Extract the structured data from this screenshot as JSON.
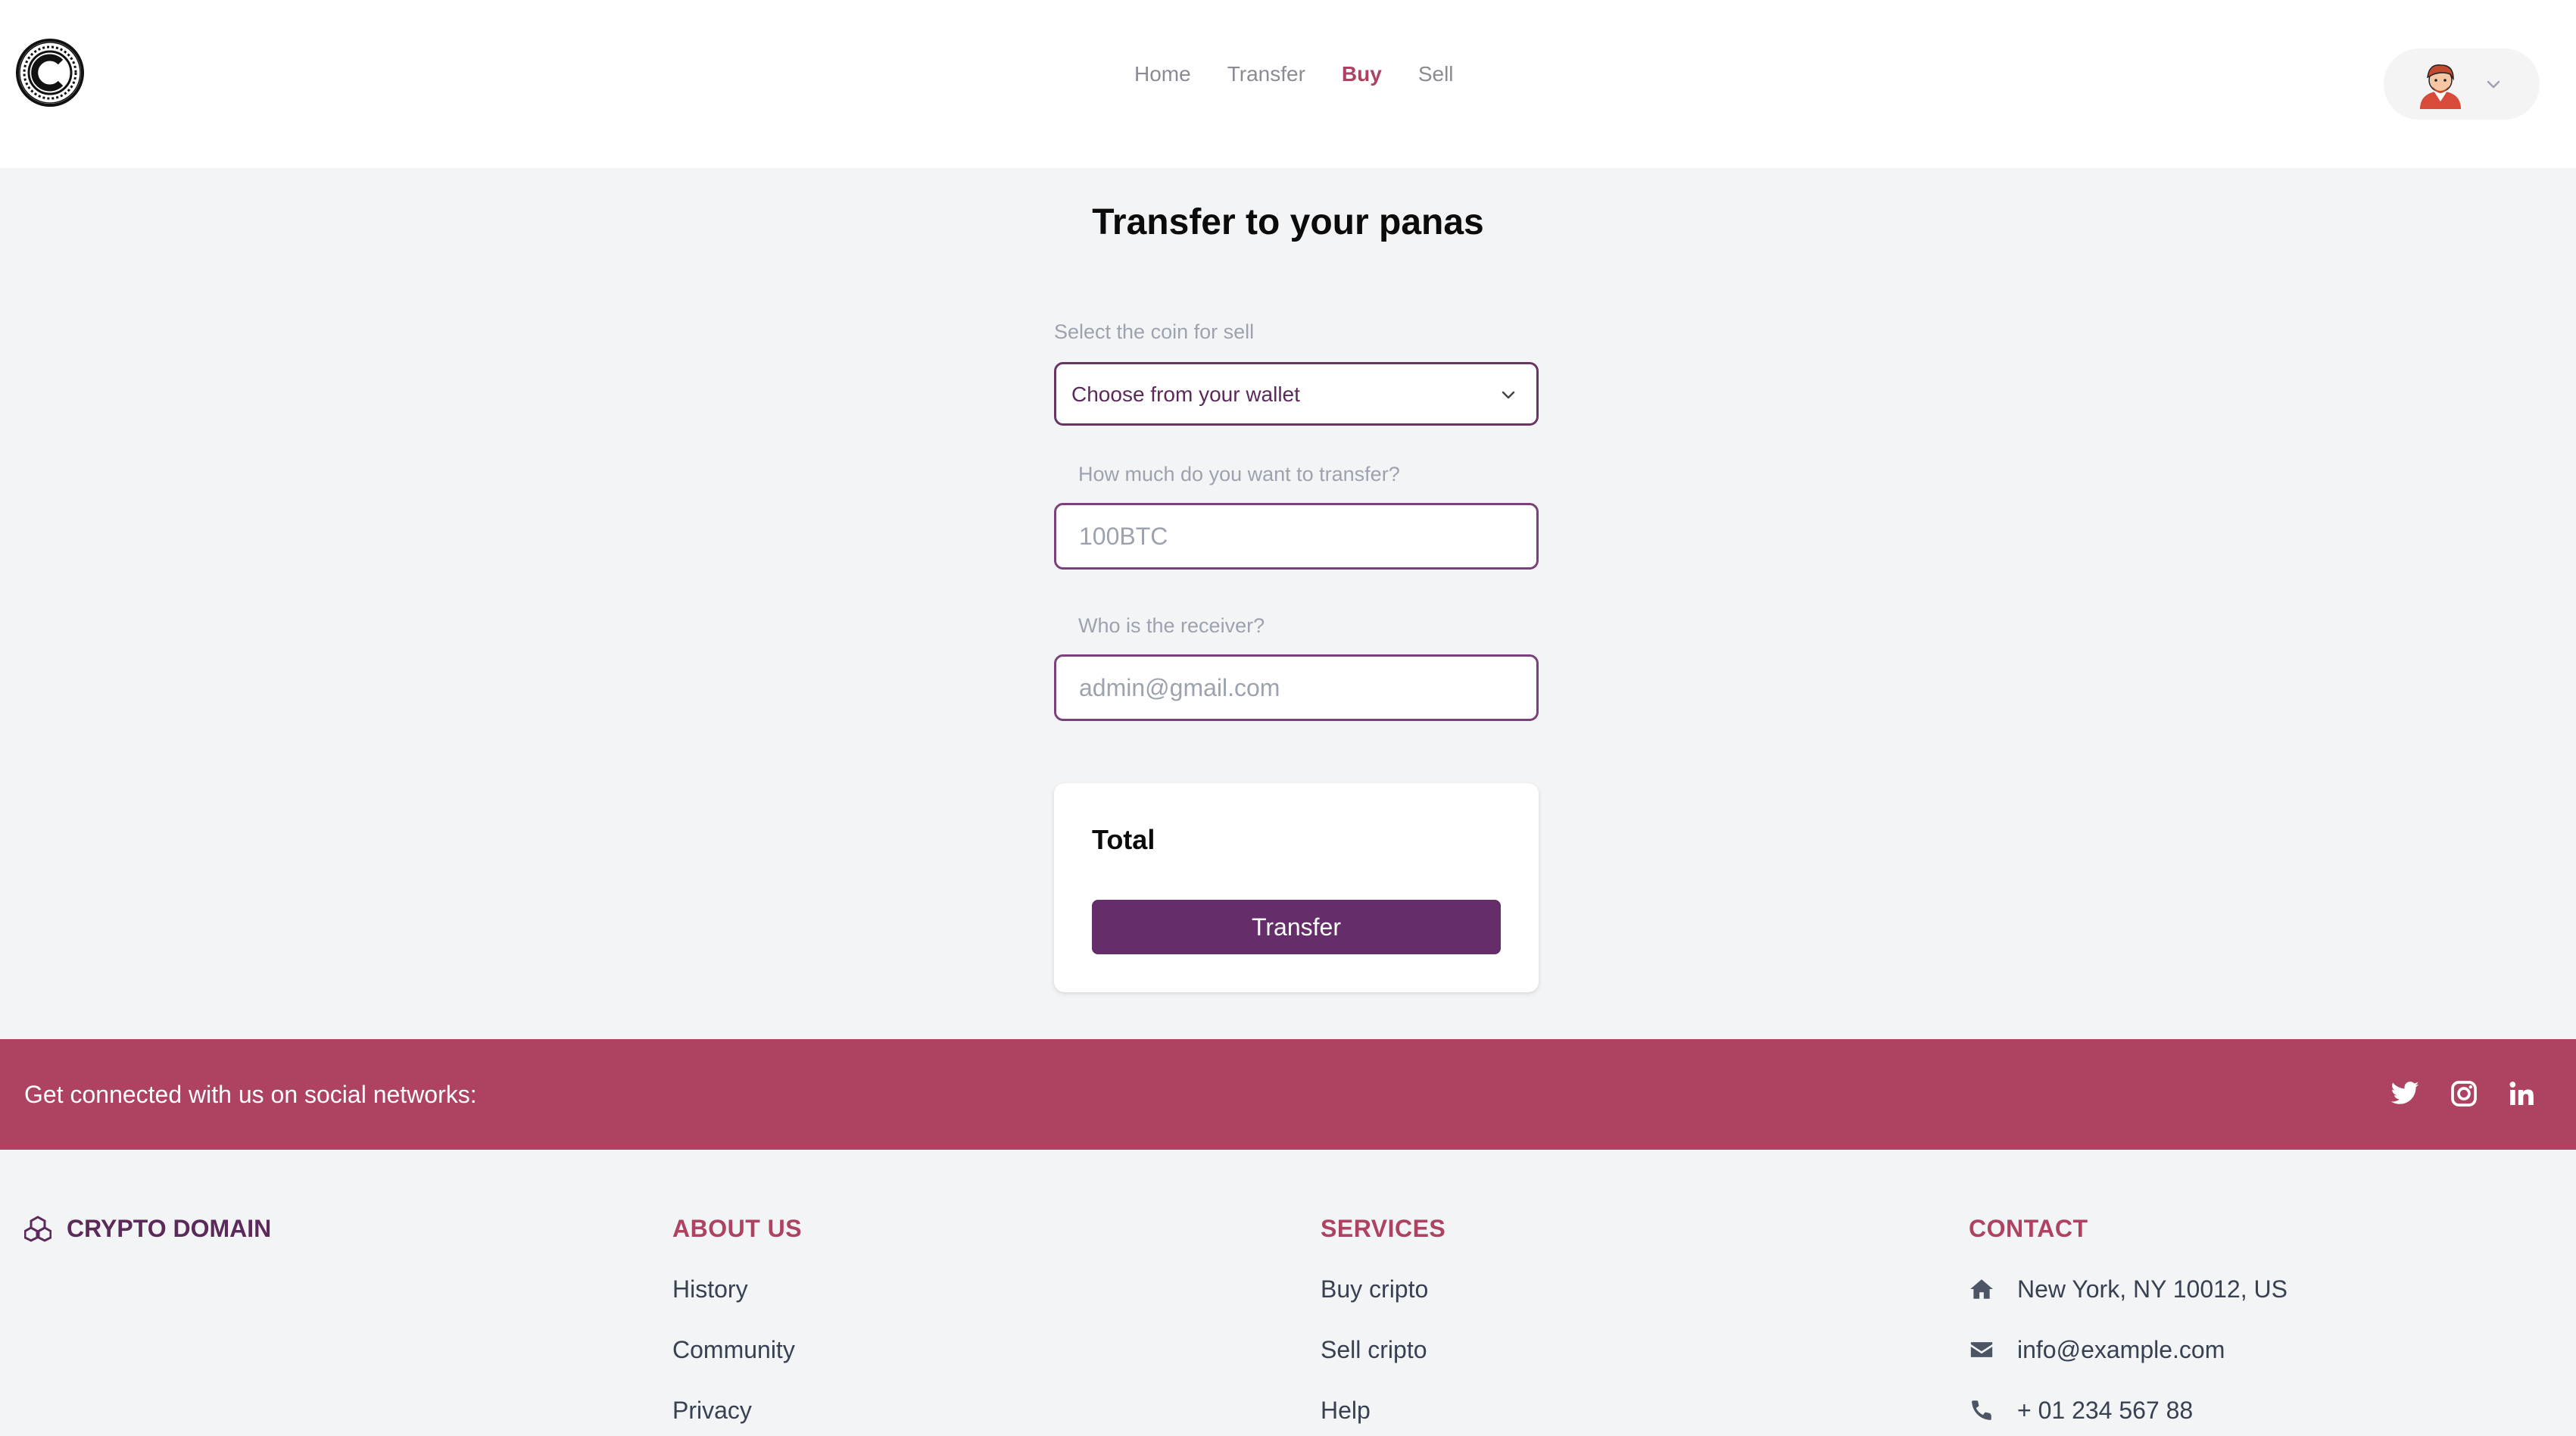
{
  "header": {
    "nav": [
      {
        "label": "Home",
        "active": false
      },
      {
        "label": "Transfer",
        "active": false
      },
      {
        "label": "Buy",
        "active": true
      },
      {
        "label": "Sell",
        "active": false
      }
    ],
    "logo_icon": "coin-logo-icon",
    "avatar_icon": "user-avatar-icon"
  },
  "main": {
    "title": "Transfer to your panas",
    "coin_label": "Select the coin for sell",
    "coin_select_value": "Choose from your wallet",
    "amount_label": "How much do you want to transfer?",
    "amount_placeholder": "100BTC",
    "receiver_label": "Who is the receiver?",
    "receiver_placeholder": "admin@gmail.com",
    "total_label": "Total",
    "transfer_button": "Transfer"
  },
  "social": {
    "text": "Get connected with us on social networks:",
    "icons": [
      "twitter-icon",
      "instagram-icon",
      "linkedin-icon"
    ]
  },
  "footer": {
    "brand": "CRYPTO DOMAIN",
    "about": {
      "heading": "ABOUT US",
      "links": [
        "History",
        "Community",
        "Privacy"
      ]
    },
    "services": {
      "heading": "SERVICES",
      "links": [
        "Buy cripto",
        "Sell cripto",
        "Help"
      ]
    },
    "contact": {
      "heading": "CONTACT",
      "address": "New York, NY 10012, US",
      "email": "info@example.com",
      "phone": "+ 01 234 567 88"
    }
  },
  "colors": {
    "accent": "#ad4261",
    "primary": "#652d69",
    "background": "#f3f4f6"
  }
}
